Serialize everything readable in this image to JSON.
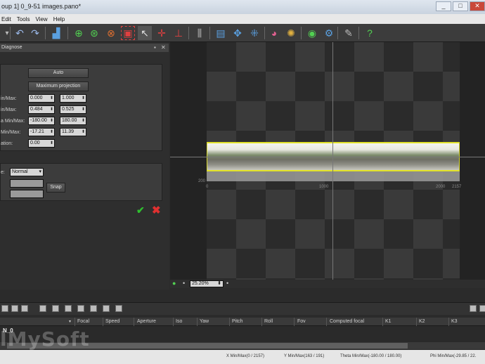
{
  "window": {
    "title": "oup 1] 0_9-51 images.pano*",
    "controls": [
      "_",
      "□",
      "✕"
    ]
  },
  "menu": [
    "Edit",
    "Tools",
    "View",
    "Help"
  ],
  "panel": {
    "title": "Diagnose",
    "auto_label": "Auto",
    "maxproj_label": "Maximum projection",
    "rows": [
      {
        "label": "in/Max:",
        "min": "0.000",
        "max": "1.000"
      },
      {
        "label": "in/Max:",
        "min": "0.484",
        "max": "0.525"
      },
      {
        "label": "a Min/Max:",
        "min": "-180.00",
        "max": "180.00"
      },
      {
        "label": "Min/Max:",
        "min": "-17.21",
        "max": "11.39"
      }
    ],
    "rotation_label": "ation:",
    "rotation_value": "0.00",
    "mode_label": "e:",
    "mode_value": "Normal",
    "snap_label": "Snap"
  },
  "viewer": {
    "zoom": "25.20%",
    "ruler_left": "200",
    "ruler_mid": "1000",
    "ruler_right_a": "2000",
    "ruler_right_b": "2157",
    "ruler_zero": "0"
  },
  "table": {
    "headers": [
      "",
      "Focal",
      "Speed",
      "Aperture",
      "Iso",
      "Yaw",
      "Pitch",
      "Roll",
      "Fov",
      "Computed focal",
      "K1",
      "K2",
      "K3"
    ],
    "row0": "N_0"
  },
  "status": {
    "x": "X Min/Max(0 / 2157)",
    "y": "Y Min/Max(163 / 191)",
    "theta": "Theta Min/Max(-180.00 / 180.00)",
    "phi": "Phi Min/Max(-29.85 / 22."
  },
  "watermark": "lMySoft"
}
